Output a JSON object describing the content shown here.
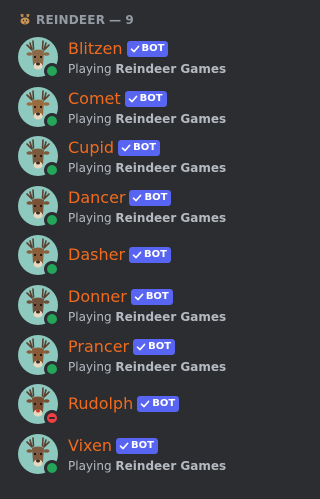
{
  "category": {
    "icon": "deer-icon",
    "title": "REINDEER",
    "separator": "—",
    "count": "9"
  },
  "colors": {
    "background": "#2b2d31",
    "name": "#f26b1d",
    "bot_tag": "#5865f2",
    "online": "#23a55a",
    "dnd": "#f23f43"
  },
  "members": [
    {
      "name": "Blitzen",
      "tag": "BOT",
      "status": "online",
      "activity_prefix": "Playing",
      "activity_name": "Reindeer Games"
    },
    {
      "name": "Comet",
      "tag": "BOT",
      "status": "online",
      "activity_prefix": "Playing",
      "activity_name": "Reindeer Games"
    },
    {
      "name": "Cupid",
      "tag": "BOT",
      "status": "online",
      "activity_prefix": "Playing",
      "activity_name": "Reindeer Games"
    },
    {
      "name": "Dancer",
      "tag": "BOT",
      "status": "online",
      "activity_prefix": "Playing",
      "activity_name": "Reindeer Games"
    },
    {
      "name": "Dasher",
      "tag": "BOT",
      "status": "online",
      "activity_prefix": "",
      "activity_name": ""
    },
    {
      "name": "Donner",
      "tag": "BOT",
      "status": "online",
      "activity_prefix": "Playing",
      "activity_name": "Reindeer Games"
    },
    {
      "name": "Prancer",
      "tag": "BOT",
      "status": "online",
      "activity_prefix": "Playing",
      "activity_name": "Reindeer Games"
    },
    {
      "name": "Rudolph",
      "tag": "BOT",
      "status": "dnd",
      "activity_prefix": "",
      "activity_name": ""
    },
    {
      "name": "Vixen",
      "tag": "BOT",
      "status": "online",
      "activity_prefix": "Playing",
      "activity_name": "Reindeer Games"
    }
  ]
}
